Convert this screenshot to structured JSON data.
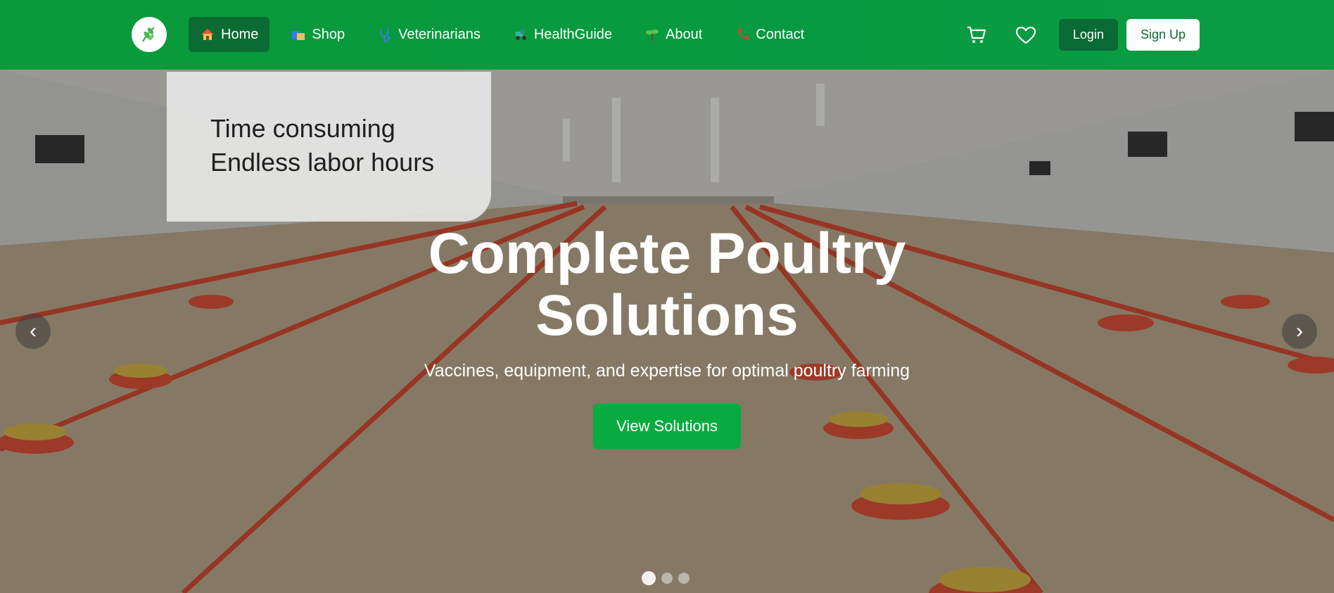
{
  "nav": {
    "items": [
      {
        "label": "Home",
        "icon": "house-icon",
        "active": true
      },
      {
        "label": "Shop",
        "icon": "shop-icon"
      },
      {
        "label": "Veterinarians",
        "icon": "stethoscope-icon"
      },
      {
        "label": "HealthGuide",
        "icon": "tractor-icon"
      },
      {
        "label": "About",
        "icon": "seedling-icon"
      },
      {
        "label": "Contact",
        "icon": "phone-icon"
      }
    ],
    "login_label": "Login",
    "signup_label": "Sign Up"
  },
  "hero": {
    "promo_line1": "Time consuming",
    "promo_line2": "Endless labor hours",
    "title_line1": "Complete Poultry",
    "title_line2": "Solutions",
    "subtitle": "Vaccines, equipment, and expertise for optimal poultry farming",
    "cta_label": "View Solutions",
    "prev_symbol": "‹",
    "next_symbol": "›",
    "slide_count": 3,
    "active_slide": 1
  },
  "colors": {
    "brand_green": "#0a9a3b",
    "dark_green": "#0a6a33",
    "cta_green": "#08ab40"
  }
}
